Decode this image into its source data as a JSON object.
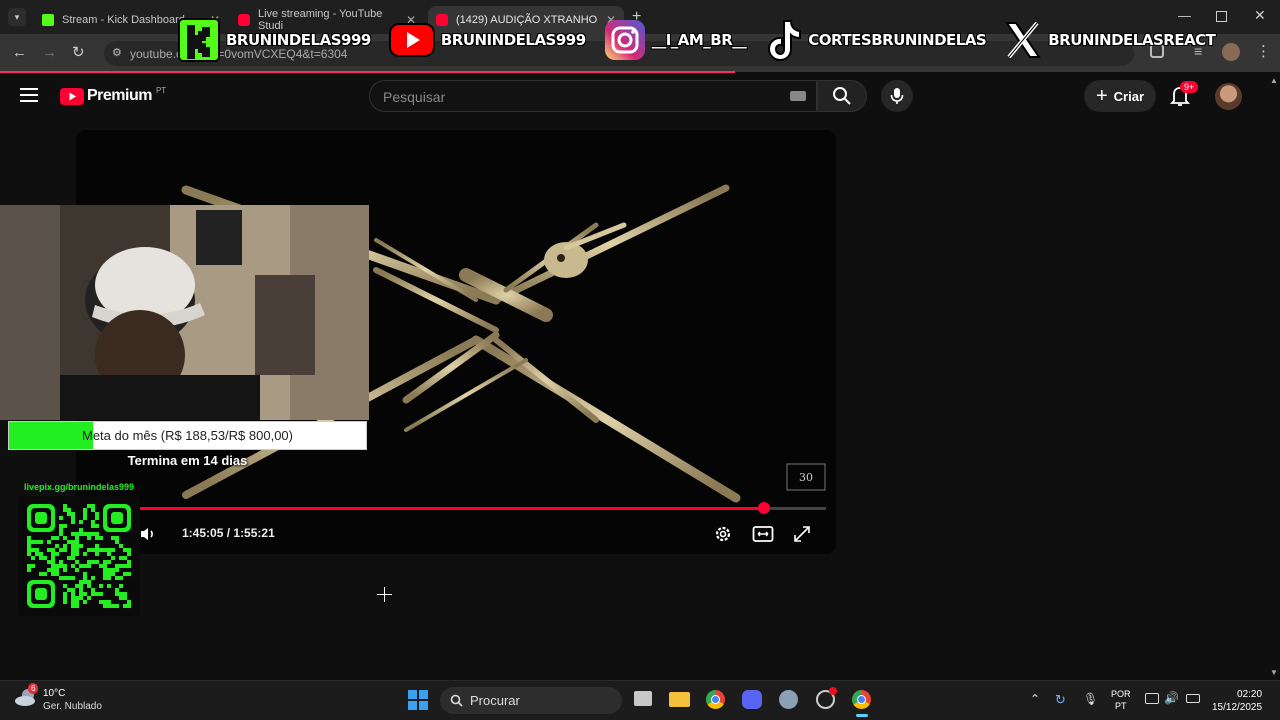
{
  "browser": {
    "tabs": [
      {
        "title": "Stream - Kick Dashboard",
        "favicon_color": "#53fc18"
      },
      {
        "title": "Live streaming - YouTube Studi",
        "favicon_color": "#ff0033"
      },
      {
        "title": "(1429) AUDIÇÃO XTRANHO",
        "favicon_color": "#ff0033"
      }
    ],
    "url": "youtube.c...ch?v=0vomVCXEQ4&t=6304"
  },
  "overlay": {
    "socials": [
      {
        "platform": "kick-icon",
        "handle": "BRUNINDELAS999",
        "color": "#53fc18"
      },
      {
        "platform": "youtube-icon",
        "handle": "BRUNINDELAS999",
        "color": "#ff0000"
      },
      {
        "platform": "instagram-icon",
        "handle": "__I_AM_BR__",
        "color": "#e1306c"
      },
      {
        "platform": "tiktok-icon",
        "handle": "CORTESBRUNINDELAS",
        "color": "#ffffff"
      },
      {
        "platform": "x-icon",
        "handle": "BRUNINDELASREACT",
        "color": "#ffffff"
      }
    ]
  },
  "youtube": {
    "logo_text": "Premium",
    "logo_region": "PT",
    "search_placeholder": "Pesquisar",
    "create_label": "Criar",
    "notifications_badge": "9+"
  },
  "player": {
    "current_time": "1:45:05",
    "separator": " / ",
    "duration": "1:55:21",
    "progress_fraction": 0.91,
    "watermark": "30"
  },
  "stream_overlay": {
    "goal_text": "Meta do mês (R$ 188,53/R$ 800,00)",
    "goal_fraction": 0.2357,
    "goal_sub": "Termina em 14 dias",
    "pix_url": "livepix.gg/brunindelas999"
  },
  "taskbar": {
    "weather_temp": "10°C",
    "weather_desc": "Ger. Nublado",
    "weather_badge": "6",
    "search_label": "Procurar",
    "lang_line1": "POR",
    "lang_line2": "PT",
    "time": "02:20",
    "date": "15/12/2025"
  }
}
